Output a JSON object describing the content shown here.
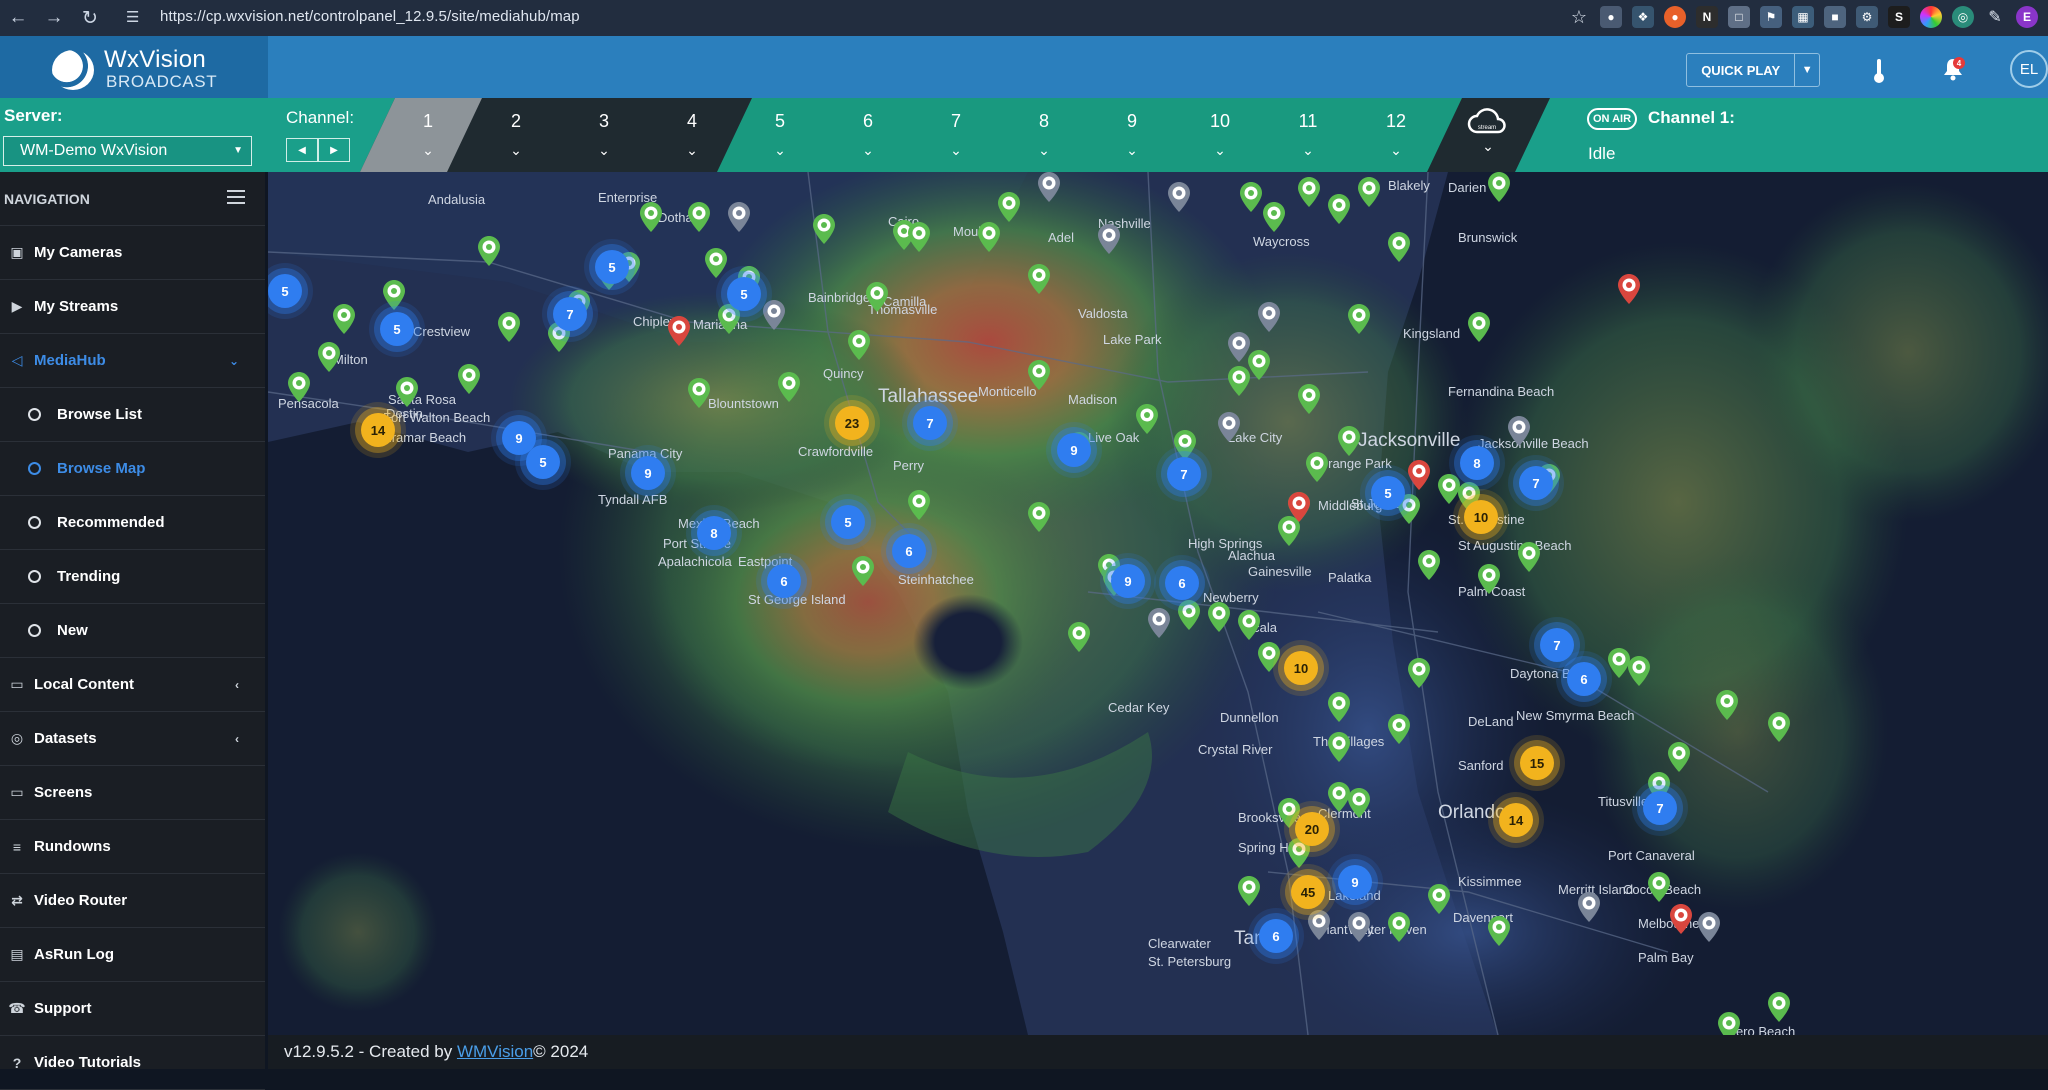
{
  "browser": {
    "url": "https://cp.wxvision.net/controlpanel_12.9.5/site/mediahub/map",
    "profile_initial": "E"
  },
  "header": {
    "logo_primary": "WxVision",
    "logo_secondary": "BROADCAST",
    "quick_play_label": "QUICK PLAY",
    "bell_badge": "4",
    "avatar_initials": "EL"
  },
  "channel_bar": {
    "server_label": "Server:",
    "server_value": "WM-Demo WxVision",
    "channel_label": "Channel:",
    "channels": [
      "1",
      "2",
      "3",
      "4",
      "5",
      "6",
      "7",
      "8",
      "9",
      "10",
      "11",
      "12"
    ],
    "active_channel": "1",
    "on_air_badge": "ON AIR",
    "on_air_channel": "Channel 1:",
    "on_air_status": "Idle"
  },
  "sidebar": {
    "heading": "NAVIGATION",
    "items": [
      {
        "label": "My Cameras",
        "icon": "camera-icon"
      },
      {
        "label": "My Streams",
        "icon": "video-icon"
      },
      {
        "label": "MediaHub",
        "icon": "share-icon",
        "expanded": true
      },
      {
        "label": "Browse List",
        "sub": true
      },
      {
        "label": "Browse Map",
        "sub": true,
        "active": true
      },
      {
        "label": "Recommended",
        "sub": true
      },
      {
        "label": "Trending",
        "sub": true
      },
      {
        "label": "New",
        "sub": true
      },
      {
        "label": "Local Content",
        "icon": "folder-icon"
      },
      {
        "label": "Datasets",
        "icon": "database-icon"
      },
      {
        "label": "Screens",
        "icon": "monitor-icon"
      },
      {
        "label": "Rundowns",
        "icon": "list-icon"
      },
      {
        "label": "Video Router",
        "icon": "swap-icon"
      },
      {
        "label": "AsRun Log",
        "icon": "log-icon"
      },
      {
        "label": "Support",
        "icon": "phone-icon"
      },
      {
        "label": "Video Tutorials",
        "icon": "help-icon"
      }
    ]
  },
  "map": {
    "labels": [
      "Blakely",
      "Andalusia",
      "Enterprise",
      "Dothan",
      "Cairo",
      "Moultrie",
      "Adel",
      "Nashville",
      "Waycross",
      "Darien",
      "Brunswick",
      "Crestview",
      "Milton",
      "Chipley",
      "Marianna",
      "Bainbridge",
      "Camilla",
      "Thomasville",
      "Valdosta",
      "Lake Park",
      "Quincy",
      "Tallahassee",
      "Monticello",
      "Madison",
      "Live Oak",
      "Lake City",
      "Pensacola",
      "Santa Rosa",
      "Destin",
      "Fort Walton Beach",
      "Miramar Beach",
      "Panama City",
      "Tyndall AFB",
      "Blountstown",
      "Crawfordville",
      "Perry",
      "Mexico Beach",
      "Port St. Joe",
      "Apalachicola",
      "Eastpoint",
      "St George Island",
      "Steinhatchee",
      "High Springs",
      "Alachua",
      "Gainesville",
      "Newberry",
      "Ocala",
      "Palatka",
      "Palm Coast",
      "Jacksonville",
      "Jacksonville Beach",
      "Orange Park",
      "Middleburg",
      "St Johns",
      "St. Augustine",
      "St Augustine Beach",
      "Fernandina Beach",
      "Kingsland",
      "Cedar Key",
      "Dunnellon",
      "Crystal River",
      "The Villages",
      "Daytona Beach",
      "New Smyrma Beach",
      "DeLand",
      "Sanford",
      "Clermont",
      "Orlando",
      "Titusville",
      "Port Canaveral",
      "Merritt Island",
      "Cocoa Beach",
      "Melbourne",
      "Palm Bay",
      "Kissimmee",
      "Davenport",
      "Lakeland",
      "Plant City",
      "Winter Haven",
      "Clearwater",
      "St. Petersburg",
      "Tampa",
      "Brooksville",
      "Spring Hill",
      "Vero Beach"
    ],
    "clusters": [
      {
        "n": "5",
        "c": "blue"
      },
      {
        "n": "5",
        "c": "blue"
      },
      {
        "n": "7",
        "c": "blue"
      },
      {
        "n": "5",
        "c": "blue"
      },
      {
        "n": "5",
        "c": "blue"
      },
      {
        "n": "14",
        "c": "gold"
      },
      {
        "n": "9",
        "c": "blue"
      },
      {
        "n": "5",
        "c": "blue"
      },
      {
        "n": "9",
        "c": "blue"
      },
      {
        "n": "23",
        "c": "gold"
      },
      {
        "n": "7",
        "c": "blue"
      },
      {
        "n": "9",
        "c": "blue"
      },
      {
        "n": "7",
        "c": "blue"
      },
      {
        "n": "5",
        "c": "blue"
      },
      {
        "n": "8",
        "c": "blue"
      },
      {
        "n": "7",
        "c": "blue"
      },
      {
        "n": "5",
        "c": "blue"
      },
      {
        "n": "6",
        "c": "blue"
      },
      {
        "n": "8",
        "c": "blue"
      },
      {
        "n": "6",
        "c": "blue"
      },
      {
        "n": "9",
        "c": "blue"
      },
      {
        "n": "6",
        "c": "blue"
      },
      {
        "n": "10",
        "c": "gold"
      },
      {
        "n": "7",
        "c": "blue"
      },
      {
        "n": "6",
        "c": "blue"
      },
      {
        "n": "10",
        "c": "gold"
      },
      {
        "n": "15",
        "c": "gold"
      },
      {
        "n": "14",
        "c": "gold"
      },
      {
        "n": "7",
        "c": "blue"
      },
      {
        "n": "20",
        "c": "gold"
      },
      {
        "n": "9",
        "c": "blue"
      },
      {
        "n": "45",
        "c": "gold"
      },
      {
        "n": "6",
        "c": "blue"
      }
    ]
  },
  "footer": {
    "version_text": "v12.9.5.2 - Created by ",
    "link_text": "WMVision",
    "copyright": " © 2024"
  }
}
